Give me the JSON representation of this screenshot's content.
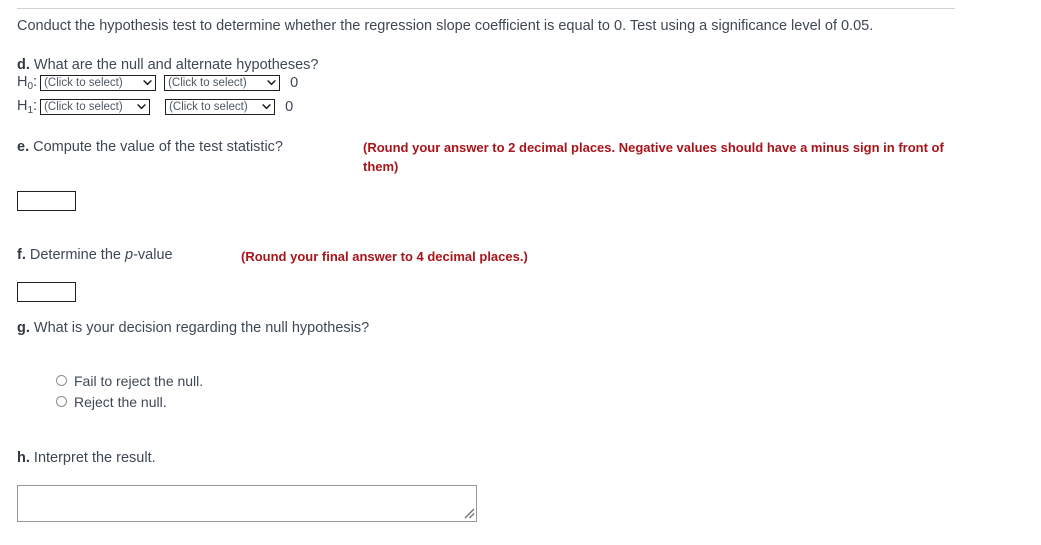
{
  "intro": {
    "text": "Conduct the hypothesis test to determine whether the regression slope coefficient is equal to 0. Test using a significance level of 0.05."
  },
  "colors": {
    "hint_red": "#a8141a",
    "body_text": "#3d4856",
    "field_border": "#1f1f1f",
    "divider": "#d2d2d2"
  },
  "parts": {
    "d": {
      "label": "d.",
      "question": "What are the null and alternate hypotheses?",
      "rows": [
        {
          "name": "H",
          "subscript": "0",
          "colon": ":",
          "select_left": "(Click to select)",
          "select_right": "(Click to select)",
          "value": "0"
        },
        {
          "name": "H",
          "subscript": "1",
          "colon": ":",
          "select_left": "(Click to select)",
          "select_right": "(Click to select)",
          "value": "0"
        }
      ]
    },
    "e": {
      "label": "e.",
      "question": "Compute the value of the test statistic?",
      "hint": "(Round your answer to 2 decimal places. Negative values should have a minus sign in front of them)",
      "answer_value": "",
      "answer_placeholder": ""
    },
    "f": {
      "label": "f.",
      "question_pre": "Determine the ",
      "question_italic": "p",
      "question_post": "-value",
      "hint": "(Round your final answer to 4 decimal places.)",
      "answer_value": "",
      "answer_placeholder": ""
    },
    "g": {
      "label": "g.",
      "question": "What is your decision regarding the null hypothesis?",
      "options": [
        "Fail to reject the null.",
        "Reject the null."
      ]
    },
    "h": {
      "label": "h.",
      "question": "Interpret the result.",
      "answer_value": "",
      "answer_placeholder": ""
    }
  },
  "icons": {
    "caret": "chevron-down-icon",
    "grip": "resize-handle-icon"
  }
}
